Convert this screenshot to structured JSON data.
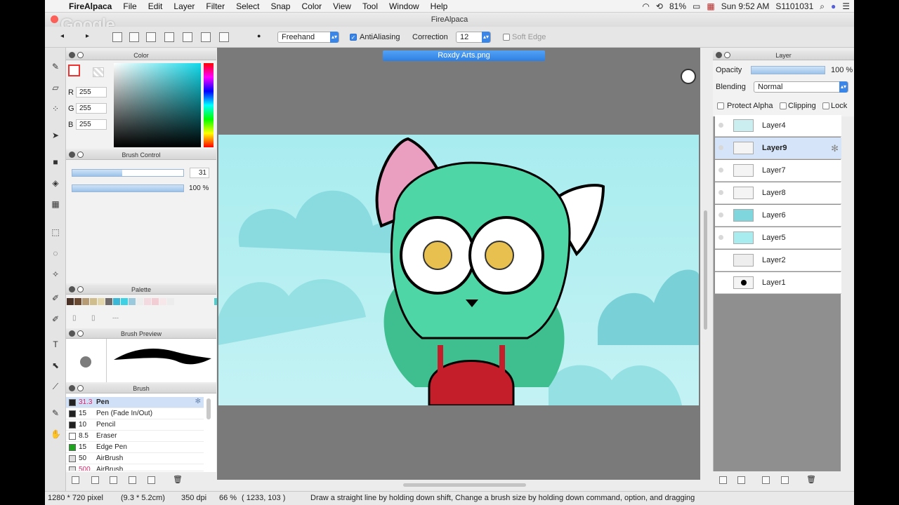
{
  "menubar": {
    "app": "FireAlpaca",
    "items": [
      "File",
      "Edit",
      "Layer",
      "Filter",
      "Select",
      "Snap",
      "Color",
      "View",
      "Tool",
      "Window",
      "Help"
    ],
    "battery": "81%",
    "clock": "Sun 9:52 AM",
    "user": "S1101031"
  },
  "window": {
    "title": "FireAlpaca"
  },
  "watermark": "Google",
  "toolbar": {
    "mode": "Freehand",
    "antialiasing_label": "AntiAliasing",
    "correction_label": "Correction",
    "correction_value": "12",
    "soft_edge_label": "Soft Edge"
  },
  "color_panel": {
    "title": "Color",
    "r_label": "R",
    "r": "255",
    "g_label": "G",
    "g": "255",
    "b_label": "B",
    "b": "255"
  },
  "brush_control": {
    "title": "Brush Control",
    "size": "31",
    "opacity": "100 %",
    "size_fraction": 0.45,
    "opacity_fraction": 1.0
  },
  "palette": {
    "title": "Palette",
    "colors": [
      "#4a3326",
      "#6b4a33",
      "#b79b74",
      "#cfbd8e",
      "#e2d6aa",
      "#706a6a",
      "#3bb7d8",
      "#3fd0e4",
      "#9ac8dd",
      "#ededed",
      "#f3d9e0",
      "#f2ced4",
      "#f8e7ea",
      "#ececec",
      "#4ccfd0"
    ],
    "dash_label": "---"
  },
  "brush_preview": {
    "title": "Brush Preview"
  },
  "brush_list": {
    "title": "Brush",
    "items": [
      {
        "size": "31.3",
        "name": "Pen",
        "color": "#222222"
      },
      {
        "size": "15",
        "name": "Pen (Fade In/Out)",
        "color": "#222222"
      },
      {
        "size": "10",
        "name": "Pencil",
        "color": "#222222"
      },
      {
        "size": "8.5",
        "name": "Eraser",
        "color": "#ffffff"
      },
      {
        "size": "15",
        "name": "Edge Pen",
        "color": "#1da51d"
      },
      {
        "size": "50",
        "name": "AirBrush",
        "color": "#dddddd"
      },
      {
        "size": "500",
        "name": "AirBrush",
        "color": "#dddddd"
      }
    ]
  },
  "document": {
    "tab": "Roxdy Arts.png"
  },
  "layer_panel": {
    "title": "Layer",
    "opacity_label": "Opacity",
    "opacity_value": "100 %",
    "blending_label": "Blending",
    "blending_value": "Normal",
    "protect_alpha": "Protect Alpha",
    "clipping": "Clipping",
    "lock": "Lock",
    "layers": [
      "Layer4",
      "Layer9",
      "Layer7",
      "Layer8",
      "Layer6",
      "Layer5",
      "Layer2",
      "Layer1"
    ],
    "selected": "Layer9"
  },
  "status": {
    "size": "1280 * 720 pixel",
    "cm": "(9.3 * 5.2cm)",
    "dpi": "350 dpi",
    "zoom": "66 %",
    "coords": "( 1233, 103 )",
    "hint": "Draw a straight line by holding down shift, Change a brush size by holding down command, option, and dragging"
  }
}
